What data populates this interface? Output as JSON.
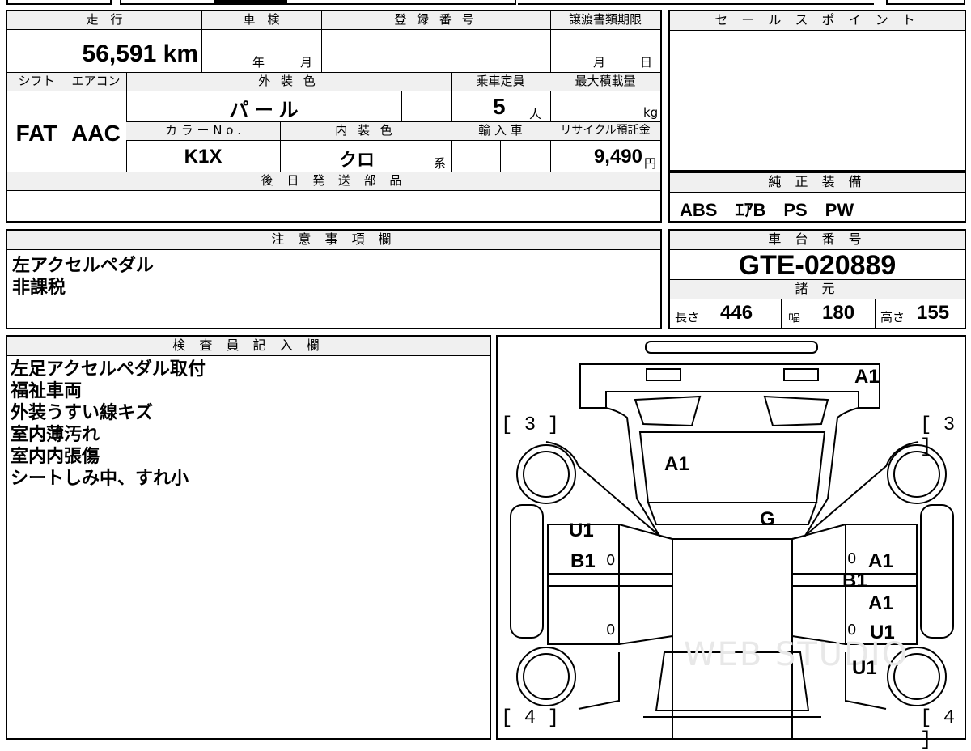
{
  "main": {
    "headers": {
      "mileage": "走　行",
      "inspection": "車　検",
      "registration": "登 録 番 号",
      "transfer_deadline": "譲渡書類期限",
      "shift": "シフト",
      "aircon": "エアコン",
      "exterior_color": "外 装 色",
      "capacity": "乗車定員",
      "max_load": "最大積載量",
      "color_no": "カ ラ ー N o .",
      "interior_color": "内 装 色",
      "import": "輸 入 車",
      "recycle": "リサイクル預託金",
      "later_parts": "後 日 発 送 部 品"
    },
    "mileage": "56,591 km",
    "year_unit": "年",
    "month_unit": "月",
    "month_unit2": "月",
    "day_unit": "日",
    "shift": "FAT",
    "aircon": "AAC",
    "exterior_color": "パ ー ル",
    "capacity": "5",
    "capacity_unit": "人",
    "max_load_unit": "kg",
    "color_no": "K1X",
    "interior_color": "クロ",
    "interior_suffix": "系",
    "recycle_fee": "9,490",
    "recycle_unit": "円"
  },
  "sales_point": {
    "header": "セ ー ル ス ポ イ ン ト"
  },
  "equipment": {
    "header": "純 正 装 備",
    "value": "ABS　ｴｱB　PS　PW"
  },
  "notes": {
    "header": "注 意 事 項 欄",
    "lines": [
      "左アクセルペダル",
      "非課税"
    ]
  },
  "chassis": {
    "header": "車 台 番 号",
    "value": "GTE-020889"
  },
  "specs": {
    "header": "諸 元",
    "length_label": "長さ",
    "length": "446",
    "width_label": "幅",
    "width": "180",
    "height_label": "高さ",
    "height": "155"
  },
  "inspector": {
    "header": "検 査 員 記 入 欄",
    "lines": [
      "左足アクセルペダル取付",
      "福祉車両",
      "外装うすい線キズ",
      "室内薄汚れ",
      "室内内張傷",
      "シートしみ中、すれ小"
    ]
  },
  "diagram": {
    "marks": {
      "front_a1": "A1",
      "windshield_a1": "A1",
      "roof_g": "G",
      "left_u1": "U1",
      "left_b1": "B1",
      "right_a1_front": "A1",
      "right_b1": "B1",
      "right_a1_rear": "A1",
      "right_u1": "U1",
      "rear_u1": "U1",
      "tire_fl": "[ 3 ]",
      "tire_fr": "[ 3 ]",
      "tire_rl": "[ 4 ]",
      "tire_rr": "[ 4 ]",
      "zero": "0"
    },
    "watermark": "WEB STUDIO"
  }
}
